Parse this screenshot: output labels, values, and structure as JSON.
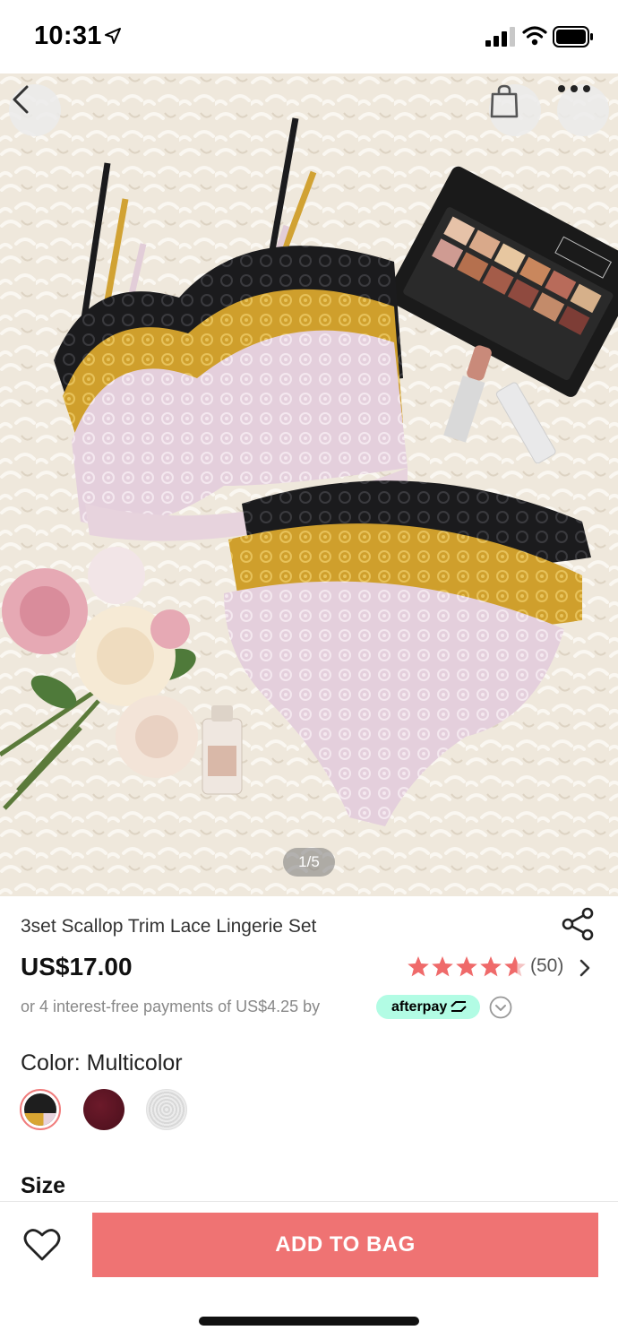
{
  "status_bar": {
    "time": "10:31"
  },
  "hero": {
    "image_counter": "1/5"
  },
  "product": {
    "title": "3set Scallop Trim Lace Lingerie Set",
    "price": "US$17.00",
    "rating": 4.5,
    "review_count": "(50)",
    "afterpay_text": "or 4 interest-free payments of US$4.25 by",
    "afterpay_brand": "afterpay",
    "color_label": "Color: Multicolor",
    "size_label": "Size",
    "swatches": [
      "multicolor",
      "burgundy",
      "white-lace"
    ]
  },
  "actions": {
    "add_to_bag": "ADD TO BAG"
  },
  "colors": {
    "accent": "#ef7373",
    "afterpay_mint": "#b2fce4",
    "star": "#ef6a6a"
  }
}
